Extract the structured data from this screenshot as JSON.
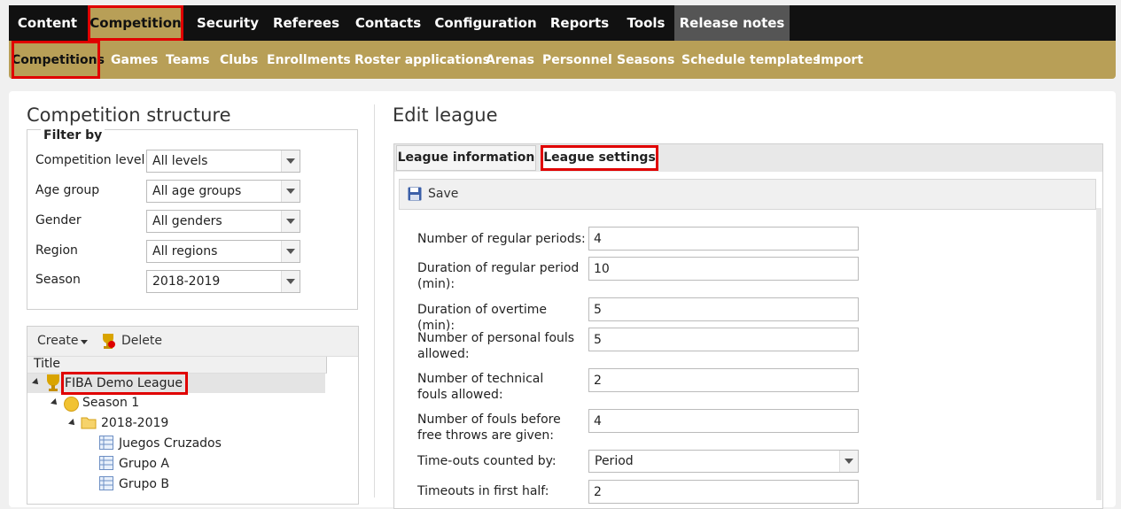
{
  "topnav": {
    "items": [
      "Content",
      "Competition",
      "Security",
      "Referees",
      "Contacts",
      "Configuration",
      "Reports",
      "Tools",
      "Release notes"
    ]
  },
  "subnav": {
    "items": [
      "Competitions",
      "Games",
      "Teams",
      "Clubs",
      "Enrollments",
      "Roster applications",
      "Arenas",
      "Personnel",
      "Seasons",
      "Schedule templates",
      "Import"
    ]
  },
  "left": {
    "title": "Competition structure",
    "filter_legend": "Filter by",
    "filters": [
      {
        "label": "Competition level",
        "value": "All levels"
      },
      {
        "label": "Age group",
        "value": "All age groups"
      },
      {
        "label": "Gender",
        "value": "All genders"
      },
      {
        "label": "Region",
        "value": "All regions"
      },
      {
        "label": "Season",
        "value": "2018-2019"
      }
    ],
    "tree_toolbar": {
      "create": "Create",
      "delete": "Delete"
    },
    "tree_header": "Title",
    "tree": [
      "FIBA Demo League",
      "Season 1",
      "2018-2019",
      "Juegos Cruzados",
      "Grupo A",
      "Grupo B"
    ]
  },
  "right": {
    "title": "Edit league",
    "tabs": [
      "League information",
      "League settings"
    ],
    "save_label": "Save",
    "fields": [
      {
        "label": "Number of regular periods:",
        "value": "4"
      },
      {
        "label": "Duration of regular period (min):",
        "value": "10"
      },
      {
        "label": "Duration of overtime (min):",
        "value": "5"
      },
      {
        "label": "Number of personal fouls allowed:",
        "value": "5"
      },
      {
        "label": "Number of technical fouls allowed:",
        "value": "2"
      },
      {
        "label": "Number of fouls before free throws are given:",
        "value": "4"
      },
      {
        "label": "Time-outs counted by:",
        "value": "Period"
      },
      {
        "label": "Timeouts in first half:",
        "value": "2"
      }
    ]
  },
  "colors": {
    "nav_bg": "#111111",
    "accent": "#b89f57",
    "highlight": "#e00000"
  }
}
